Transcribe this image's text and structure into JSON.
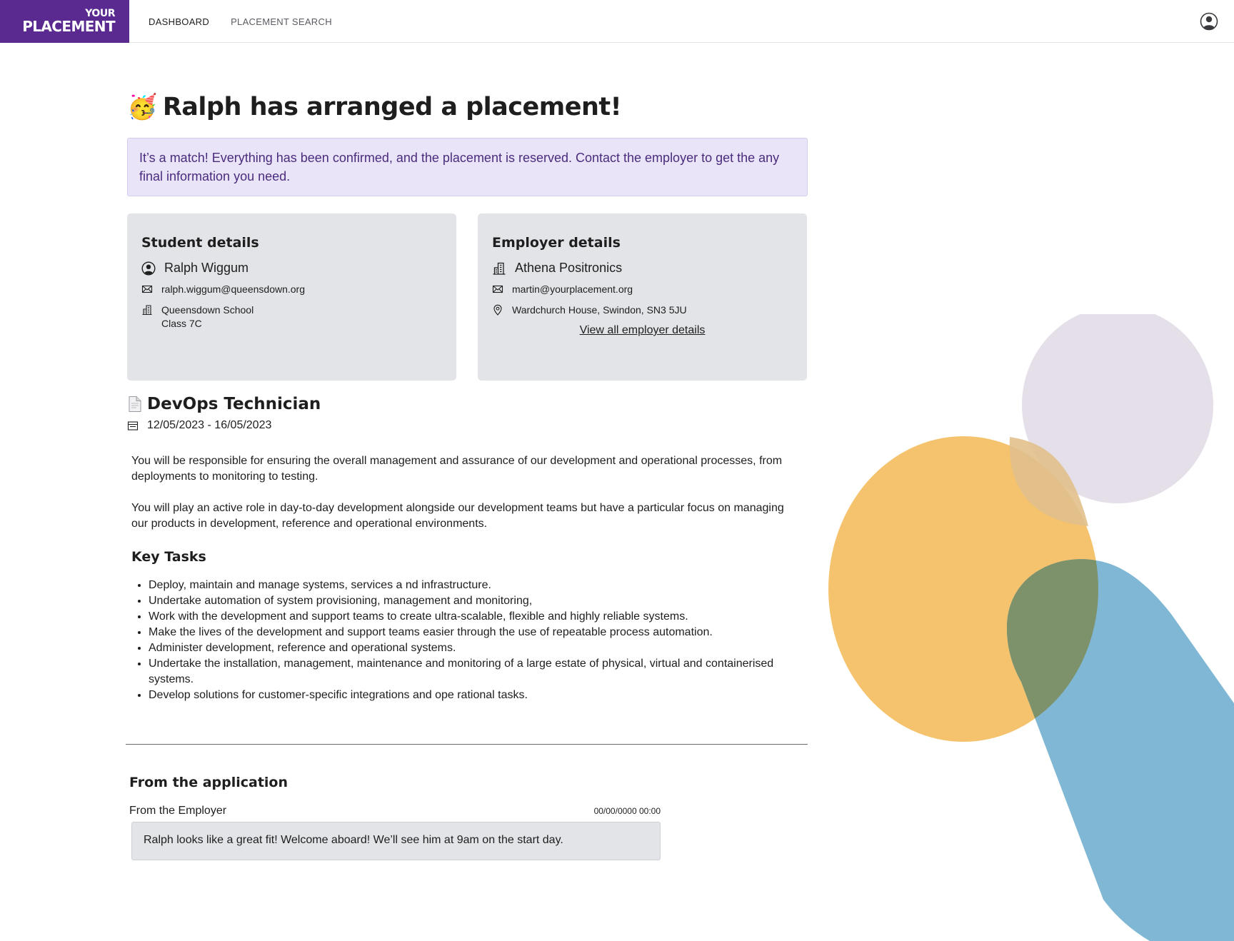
{
  "app": {
    "logo_line1": "YOUR",
    "logo_line2": "PLACEMENT",
    "brand_color": "#5a2a91"
  },
  "nav": {
    "items": [
      {
        "label": "DASHBOARD",
        "active": true
      },
      {
        "label": "PLACEMENT SEARCH",
        "active": false
      }
    ],
    "account_icon": "account-circle-icon"
  },
  "page": {
    "emoji": "🥳",
    "title": "Ralph has arranged a placement!",
    "banner": "It’s a match! Everything has been confirmed, and the placement is reserved. Contact the employer to get the any final information you need."
  },
  "student": {
    "heading": "Student details",
    "name": "Ralph Wiggum",
    "email": "ralph.wiggum@queensdown.org",
    "school": "Queensdown School",
    "class": "Class 7C"
  },
  "employer": {
    "heading": "Employer details",
    "name": "Athena Positronics",
    "email": "martin@yourplacement.org",
    "address": "Wardchurch House, Swindon, SN3 5JU",
    "view_link": "View all employer details"
  },
  "role": {
    "title": "DevOps Technician",
    "dates": "12/05/2023 - 16/05/2023",
    "paragraph1": "You will be responsible for ensuring the overall management and assurance of our development and operational processes, from deployments to monitoring to testing.",
    "paragraph2": "You will play an active role in day-to-day development alongside our development teams but have a particular focus on managing our products in development, reference and operational environments.",
    "tasks_heading": "Key Tasks",
    "tasks": [
      "Deploy, maintain and manage systems, services a nd infrastructure.",
      "Undertake automation of system provisioning, management and monitoring,",
      "Work with the development and support teams to create ultra-scalable, flexible and highly reliable systems.",
      "Make the lives of the development and support teams easier through the use of repeatable process automation.",
      "Administer development, reference and operational systems.",
      "Undertake the installation, management, maintenance and monitoring of a large estate of physical, virtual and containerised systems.",
      "Develop solutions for customer-specific integrations and ope   rational tasks."
    ]
  },
  "application": {
    "heading": "From the application",
    "from_label": "From the Employer",
    "timestamp": "00/00/0000 00:00",
    "message": "Ralph looks like a great fit! Welcome aboard! We’ll see him at 9am on the start day."
  },
  "colors": {
    "banner_bg": "#e9e4f8",
    "card_bg": "#e3e4e8",
    "deco_orange": "#f5c36e",
    "deco_lilac": "#e5dfe9",
    "deco_blue": "#80b7d4",
    "deco_overlap": "#7d926a"
  }
}
